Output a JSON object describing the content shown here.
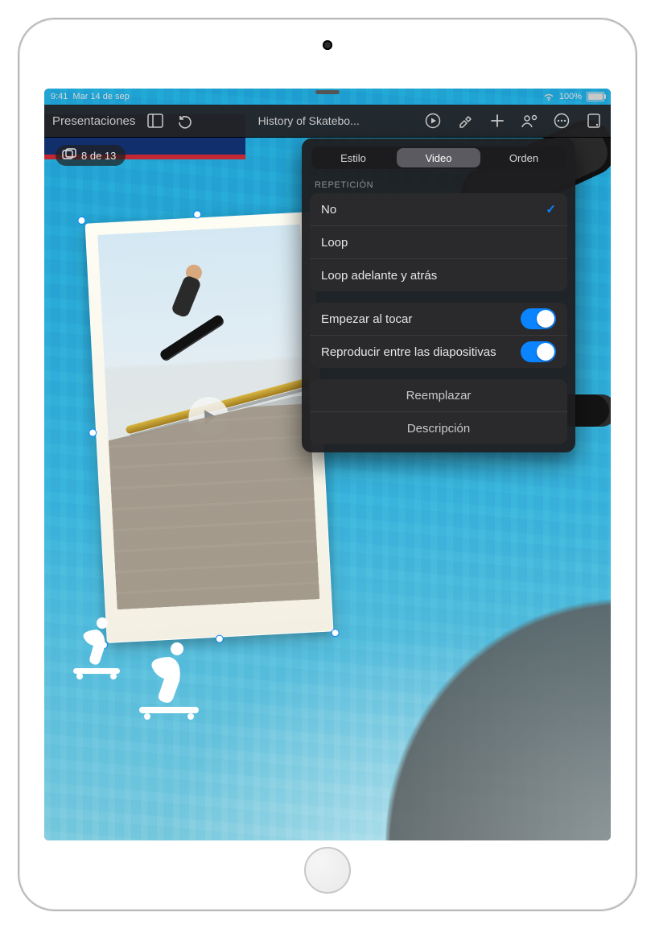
{
  "status_bar": {
    "time": "9:41",
    "date": "Mar 14 de sep",
    "battery_percent": "100%"
  },
  "toolbar": {
    "back_label": "Presentaciones",
    "document_title": "History of Skatebo..."
  },
  "slide_counter": {
    "text": "8 de 13"
  },
  "popover": {
    "tabs": {
      "style": "Estilo",
      "video": "Video",
      "order": "Orden"
    },
    "repetition_section_label": "REPETICIÓN",
    "repetition_options": {
      "none": "No",
      "loop": "Loop",
      "loop_back_forth": "Loop adelante y atrás"
    },
    "toggles": {
      "start_on_tap": "Empezar al tocar",
      "play_across_slides": "Reproducir entre las diapositivas"
    },
    "actions": {
      "replace": "Reemplazar",
      "description": "Descripción"
    }
  }
}
